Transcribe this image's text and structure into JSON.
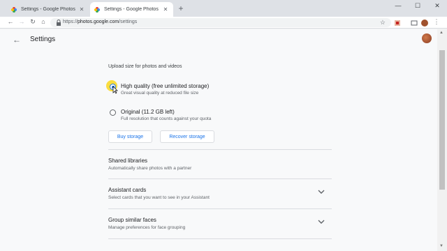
{
  "browser": {
    "tabs": [
      {
        "title": "Settings - Google Photos",
        "active": false
      },
      {
        "title": "Settings - Google Photos",
        "active": true
      }
    ],
    "new_tab_icon": "plus-icon",
    "url_protocol": "https://",
    "url_host": "photos.google.com",
    "url_path": "/settings",
    "window_controls": [
      "minimize",
      "maximize",
      "close"
    ]
  },
  "header": {
    "title": "Settings"
  },
  "upload": {
    "label": "Upload size for photos and videos",
    "options": [
      {
        "title": "High quality (free unlimited storage)",
        "subtitle": "Great visual quality at reduced file size",
        "selected": true
      },
      {
        "title": "Original (11.2 GB left)",
        "subtitle": "Full resolution that counts against your quota",
        "selected": false
      }
    ],
    "buy_storage": "Buy storage",
    "recover_storage": "Recover storage"
  },
  "settings": [
    {
      "title": "Shared libraries",
      "subtitle": "Automatically share photos with a partner",
      "expandable": false
    },
    {
      "title": "Assistant cards",
      "subtitle": "Select cards that you want to see in your Assistant",
      "expandable": true
    },
    {
      "title": "Group similar faces",
      "subtitle": "Manage preferences for face grouping",
      "expandable": true
    }
  ],
  "colors": {
    "accent": "#1a73e8",
    "highlight": "#fbd300"
  }
}
